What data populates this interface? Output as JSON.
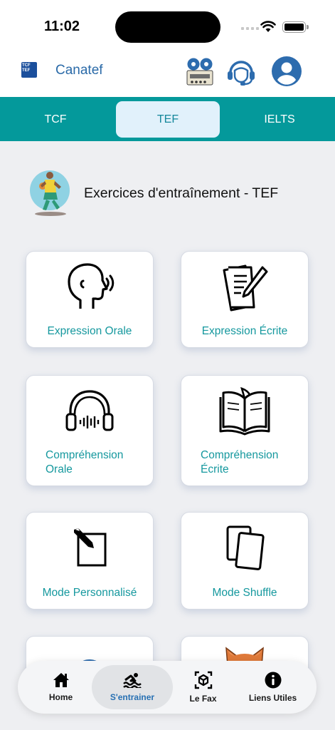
{
  "status": {
    "time": "11:02"
  },
  "header": {
    "logo_text": "TCF TEF",
    "title": "Canatef",
    "icons": [
      "recorder-icon",
      "support-headset-icon",
      "profile-icon"
    ]
  },
  "tabs": [
    {
      "label": "TCF",
      "active": false
    },
    {
      "label": "TEF",
      "active": true
    },
    {
      "label": "IELTS",
      "active": false
    }
  ],
  "section": {
    "title": "Exercices d'entraînement - TEF"
  },
  "cards": [
    {
      "label": "Expression Orale",
      "icon": "speaking-head-icon"
    },
    {
      "label": "Expression Écrite",
      "icon": "writing-paper-icon"
    },
    {
      "label_line1": "Compréhension",
      "label_line2": "Orale",
      "icon": "headphones-icon"
    },
    {
      "label_line1": "Compréhension",
      "label_line2": "Écrite",
      "icon": "open-book-icon"
    },
    {
      "label": "Mode Personnalisé",
      "icon": "edit-square-icon"
    },
    {
      "label": "Mode Shuffle",
      "icon": "cards-icon"
    }
  ],
  "nav": [
    {
      "label": "Home",
      "icon": "home-icon",
      "active": false
    },
    {
      "label": "S'entrainer",
      "icon": "swimming-icon",
      "active": true
    },
    {
      "label": "Le Fax",
      "icon": "cube-scan-icon",
      "active": false
    },
    {
      "label": "Liens Utiles",
      "icon": "info-icon",
      "active": false
    }
  ],
  "colors": {
    "accent": "#04999b",
    "label": "#15989e",
    "nav_active": "#2770b3"
  }
}
